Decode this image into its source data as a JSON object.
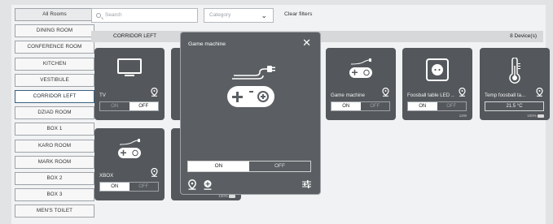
{
  "sidebar": {
    "items": [
      {
        "label": "All Rooms",
        "state": "all"
      },
      {
        "label": "DINING ROOM"
      },
      {
        "label": "CONFERENCE ROOM"
      },
      {
        "label": "KITCHEN"
      },
      {
        "label": "VESTIBULE"
      },
      {
        "label": "CORRIDOR LEFT",
        "state": "active"
      },
      {
        "label": "DZIAD ROOM"
      },
      {
        "label": "BOX 1"
      },
      {
        "label": "KARO ROOM"
      },
      {
        "label": "MARK ROOM"
      },
      {
        "label": "BOX 2"
      },
      {
        "label": "BOX 3"
      },
      {
        "label": "MEN'S TOILET"
      }
    ]
  },
  "toolbar": {
    "search_placeholder": "Search",
    "category_placeholder": "Category",
    "clear_label": "Clear filters"
  },
  "room": {
    "name": "CORRIDOR LEFT",
    "device_count": "8 Device(s)"
  },
  "devices": [
    {
      "name": "TV",
      "icon": "tv-icon",
      "on_label": "ON",
      "off_label": "OFF",
      "state": "off"
    },
    {
      "name": "Game machine",
      "icon": "gamepad-icon",
      "on_label": "ON",
      "off_label": "OFF",
      "state": "on"
    },
    {
      "name": "Foosball table LED ...",
      "icon": "socket-icon",
      "on_label": "ON",
      "off_label": "OFF",
      "state": "on",
      "extra": "12W"
    },
    {
      "name": "Temp foosball ta...",
      "icon": "thermometer-icon",
      "value": "21.5 °C",
      "extra": "100%"
    },
    {
      "name": "XBOX",
      "icon": "gamepad-icon",
      "on_label": "ON",
      "off_label": "OFF",
      "state": "on"
    },
    {
      "extra": "100%"
    }
  ],
  "modal": {
    "title": "Game machine",
    "icon": "gamepad-icon",
    "on_label": "ON",
    "off_label": "OFF",
    "state": "on"
  },
  "colors": {
    "tile": "#54585c",
    "modal": "#5b5f63",
    "active_border": "#3a5f7d"
  }
}
